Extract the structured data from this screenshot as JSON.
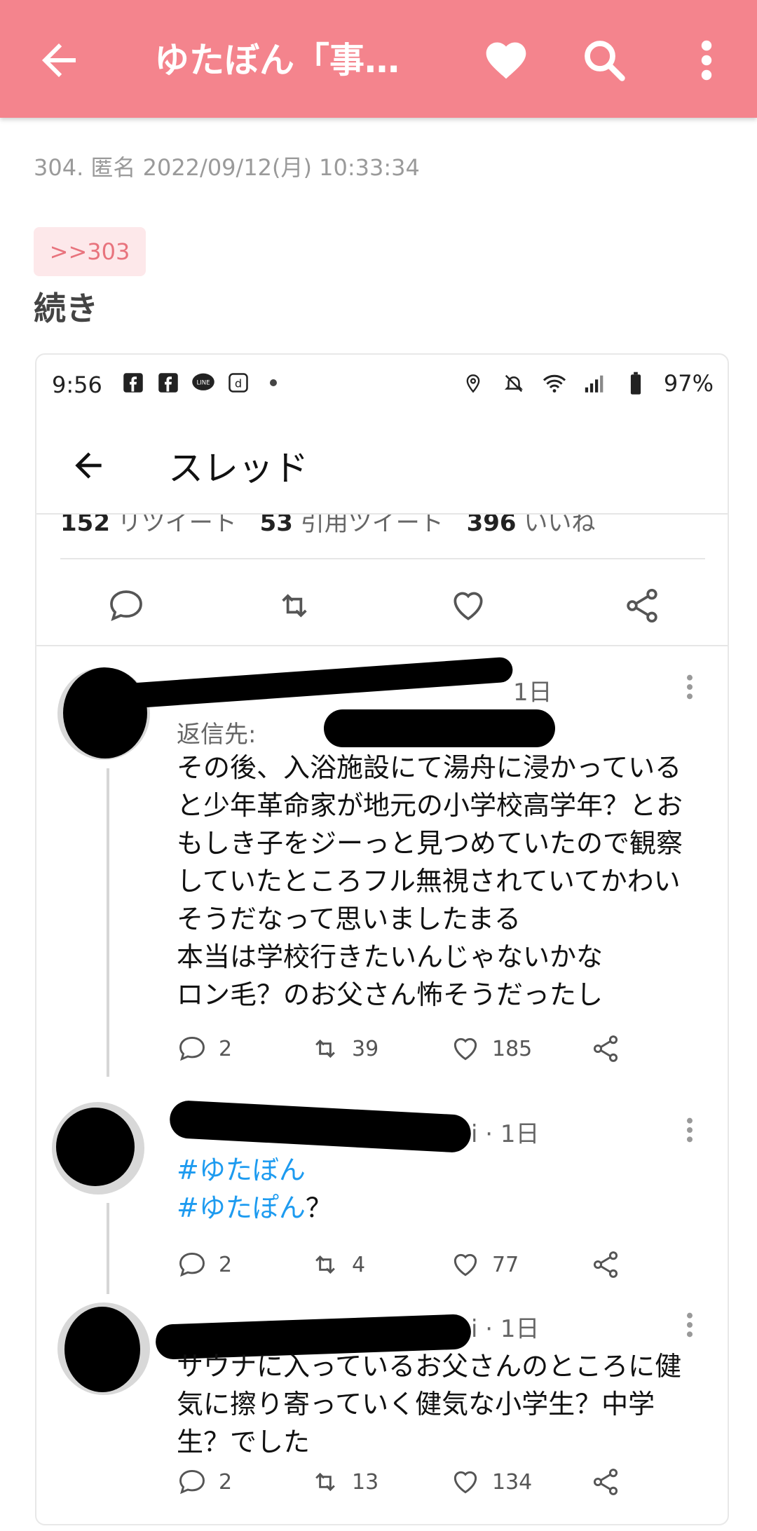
{
  "appbar": {
    "title": "ゆたぼん「事…",
    "bg": "#f4848d"
  },
  "post": {
    "meta": "304. 匿名 2022/09/12(月) 10:33:34",
    "anchor": ">>303",
    "text": "続き"
  },
  "screenshot": {
    "status": {
      "time": "9:56",
      "battery": "97%"
    },
    "header_title": "スレッド",
    "stats": {
      "retweets": "152",
      "retweets_label": "リツイート",
      "quotes": "53",
      "quotes_label": "引用ツイート",
      "likes": "396",
      "likes_label": "いいね"
    },
    "tweets": [
      {
        "time": "1日",
        "reply_prefix": "返信先:",
        "text": [
          "その後、入浴施設にて湯舟に浸かっている",
          "と少年革命家が地元の小学校高学年？とお",
          "もしき子をジーっと見つめていたので観察",
          "していたところフル無視されていてかわい",
          "そうだなって思いましたまる",
          "本当は学校行きたいんじゃないかな",
          "ロン毛？のお父さん怖そうだったし"
        ],
        "replies": "2",
        "retweets": "39",
        "likes": "185"
      },
      {
        "time": "i · 1日",
        "hashtags": [
          "#ゆたぼん",
          "#ゆたぽん"
        ],
        "hashtag_suffix": "？",
        "replies": "2",
        "retweets": "4",
        "likes": "77"
      },
      {
        "time": "i · 1日",
        "text": [
          "サウナに入っているお父さんのところに健",
          "気に擦り寄っていく健気な小学生？中学",
          "生？でした"
        ],
        "replies": "2",
        "retweets": "13",
        "likes": "134"
      }
    ]
  }
}
